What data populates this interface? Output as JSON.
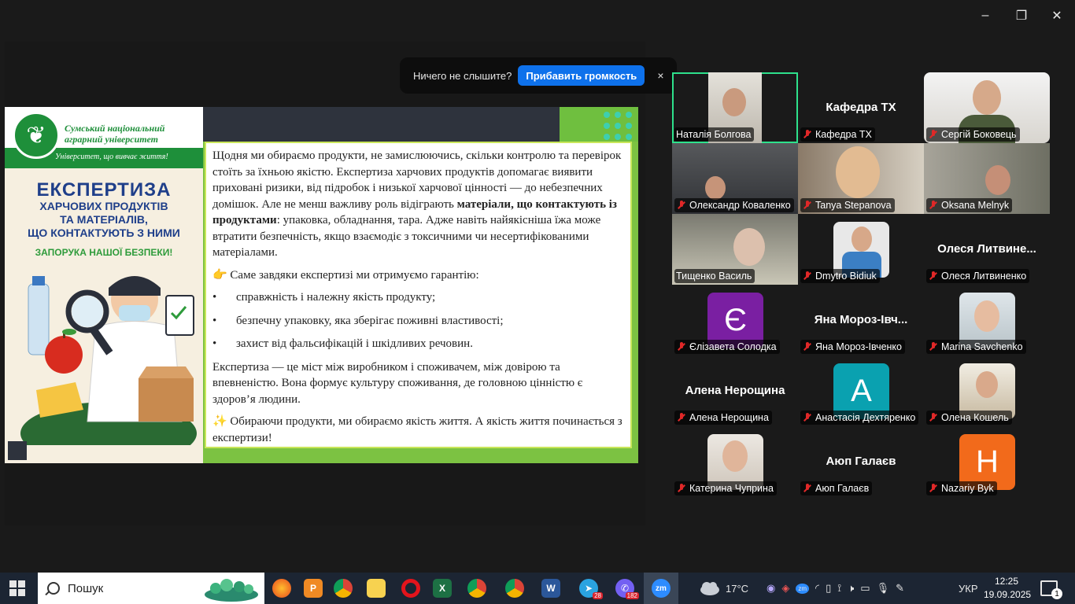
{
  "window": {
    "min": "–",
    "max": "❐",
    "close": "✕"
  },
  "notification": {
    "text": "Ничего не слышите?",
    "button": "Прибавить громкость",
    "close": "×"
  },
  "slide": {
    "university_name": "Сумський національний аграрний університет",
    "motto": "Університет, що вивчає життя!",
    "poster_title": "ЕКСПЕРТИЗА",
    "poster_subtitle_1": "ХАРЧОВИХ ПРОДУКТІВ",
    "poster_subtitle_2": "ТА МАТЕРІАЛІВ,",
    "poster_subtitle_3": "ЩО КОНТАКТУЮТЬ З НИМИ",
    "poster_slogan": "ЗАПОРУКА НАШОЇ БЕЗПЕКИ!",
    "para1_a": "Щодня ми обираємо продукти, не замислюючись, скільки контролю та перевірок стоїть за їхньою якістю. Експертиза харчових продуктів допомагає виявити приховані ризики, від підробок і низької харчової цінності — до небезпечних домішок. Але не менш важливу роль відіграють ",
    "para1_bold": "матеріали, що контактують із продуктами",
    "para1_b": ": упаковка, обладнання, тара. Адже навіть найякісніша їжа може втратити безпечність, якщо взаємодіє з токсичними чи несертифікованими матеріалами.",
    "para2": "👉 Саме завдяки експертизі ми отримуємо гарантію:",
    "bullets": [
      "справжність і належну якість продукту;",
      "безпечну упаковку, яка зберігає поживні властивості;",
      "захист від фальсифікацій і шкідливих речовин."
    ],
    "para3": "Експертиза — це міст між виробником і споживачем, між довірою та впевненістю. Вона формує культуру споживання, де головною цінністю є здоров’я людини.",
    "para4": "✨ Обираючи продукти, ми обираємо якість життя. А якість життя починається з експертизи!"
  },
  "participants": [
    {
      "name": "Наталія Болгова",
      "big": "",
      "letter": "",
      "color": ""
    },
    {
      "name": "Кафедра ТХ",
      "big": "Кафедра ТХ",
      "letter": "",
      "color": ""
    },
    {
      "name": "Сергій Боковець",
      "big": "",
      "letter": "",
      "color": ""
    },
    {
      "name": "Олександр Коваленко",
      "big": "",
      "letter": "",
      "color": ""
    },
    {
      "name": "Tanya Stepanova",
      "big": "",
      "letter": "",
      "color": ""
    },
    {
      "name": "Oksana Melnyk",
      "big": "",
      "letter": "",
      "color": ""
    },
    {
      "name": "Тищенко Василь",
      "big": "",
      "letter": "",
      "color": ""
    },
    {
      "name": "Dmytro Bidiuk",
      "big": "",
      "letter": "",
      "color": ""
    },
    {
      "name": "Олеся Литвиненко",
      "big": "Олеся  Литвине...",
      "letter": "",
      "color": ""
    },
    {
      "name": "Єлізавета Солодка",
      "big": "",
      "letter": "Є",
      "color": "#7a1fa2"
    },
    {
      "name": "Яна Мороз-Івченко",
      "big": "Яна  Мороз-Івч...",
      "letter": "",
      "color": ""
    },
    {
      "name": "Marina Savchenko",
      "big": "",
      "letter": "",
      "color": ""
    },
    {
      "name": "Алена Нерощина",
      "big": "Алена Нерощина",
      "letter": "",
      "color": ""
    },
    {
      "name": "Анастасія Дехтяренко",
      "big": "",
      "letter": "A",
      "color": "#0aa1b0"
    },
    {
      "name": "Олена Кошель",
      "big": "",
      "letter": "",
      "color": ""
    },
    {
      "name": "Катерина Чуприна",
      "big": "",
      "letter": "",
      "color": ""
    },
    {
      "name": "Аюп Галаєв",
      "big": "Аюп Галаєв",
      "letter": "",
      "color": ""
    },
    {
      "name": "Nazariy Byk",
      "big": "",
      "letter": "H",
      "color": "#f26a1b"
    }
  ],
  "taskbar": {
    "search_label": "Пошук",
    "weather": "17°C",
    "language": "УКР",
    "time": "12:25",
    "date": "19.09.2025",
    "notification_count": "1",
    "telegram_badge": "28",
    "viber_badge": "182"
  }
}
